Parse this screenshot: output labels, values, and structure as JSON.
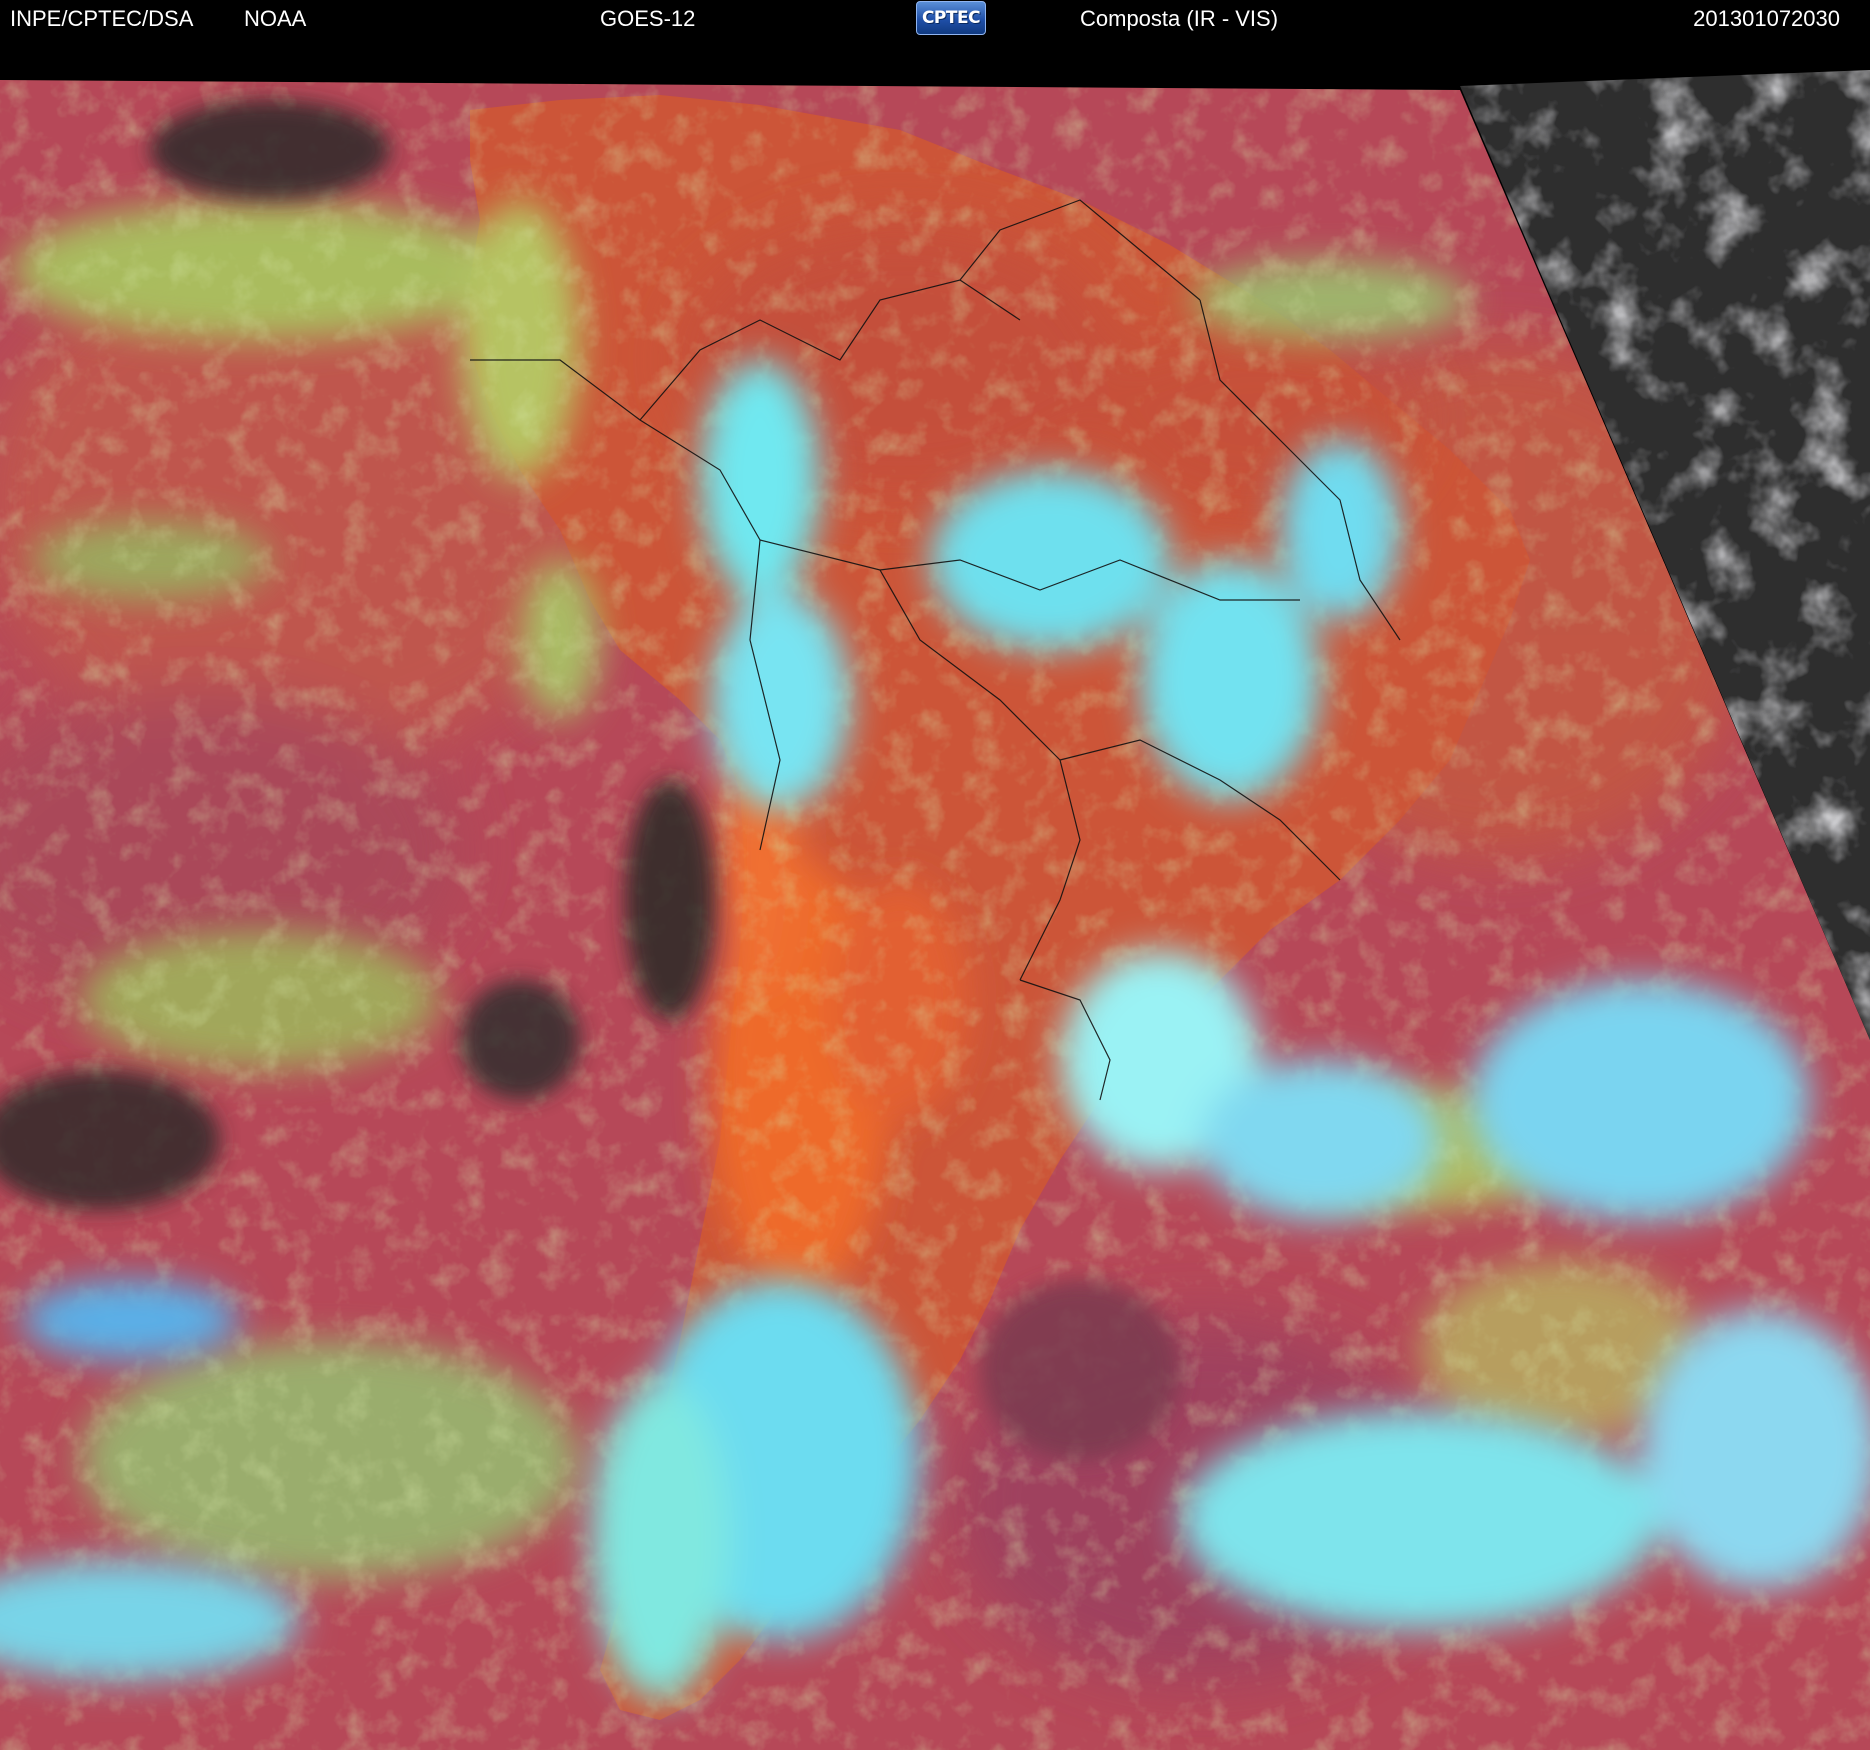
{
  "header": {
    "institution": "INPE/CPTEC/DSA",
    "agency": "NOAA",
    "satellite": "GOES-12",
    "logo": "CPTEC",
    "product": "Composta (IR - VIS)",
    "timestamp": "201301072030"
  },
  "colors": {
    "background": "#000000",
    "header_text": "#ffffff",
    "ocean_clear": "#b64858",
    "land_clear": "#cc5538",
    "desert_hot": "#ee6a2a",
    "low_cloud": "#a8c860",
    "high_cloud_cold": "#70e8f0",
    "day_side_visible": "#2e2e2e",
    "coastlines": "#111111"
  },
  "icons": {
    "logo": "cptec-logo"
  }
}
